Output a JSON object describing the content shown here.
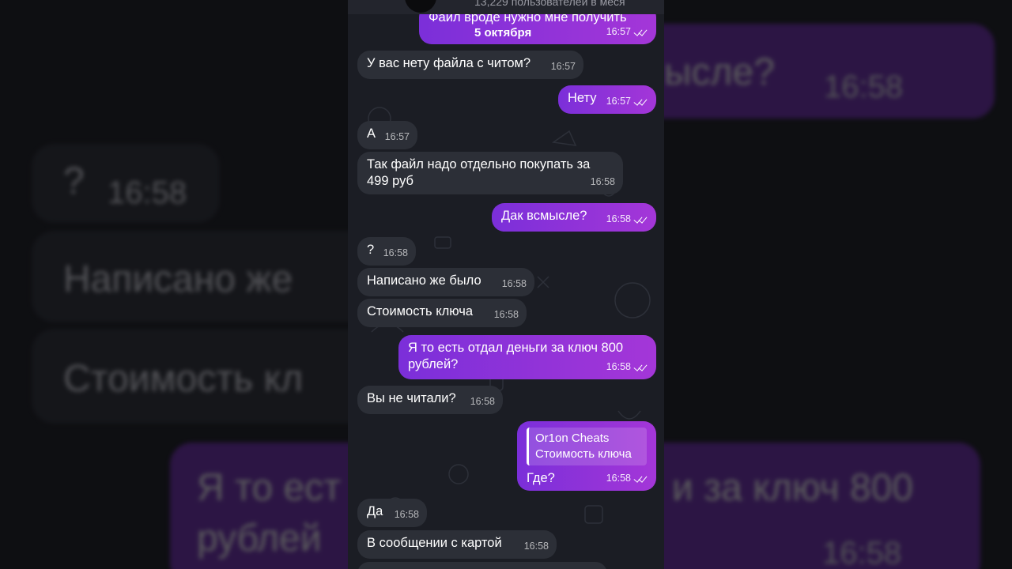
{
  "header": {
    "subtitle": "13,229 пользователей в меся"
  },
  "date_label": "5 октября",
  "colors": {
    "incoming_bubble": "#2c2f37",
    "outgoing_gradient_start": "#7b2fd9",
    "outgoing_gradient_end": "#a436d8",
    "chat_background": "#1b1d24"
  },
  "icons": {
    "read_receipt": "double-check-icon"
  },
  "messages": [
    {
      "dir": "out",
      "text": "Файл вроде нужно мне получить",
      "time": "16:57"
    },
    {
      "dir": "in",
      "text": "У вас нету файла с читом?",
      "time": "16:57"
    },
    {
      "dir": "out",
      "text": "Нету",
      "time": "16:57"
    },
    {
      "dir": "in",
      "text": "А",
      "time": "16:57"
    },
    {
      "dir": "in",
      "text": "Так файл надо отдельно покупать за",
      "text2": "499 руб",
      "time": "16:58"
    },
    {
      "dir": "out",
      "text": "Дак всмысле?",
      "time": "16:58"
    },
    {
      "dir": "in",
      "text": "?",
      "time": "16:58"
    },
    {
      "dir": "in",
      "text": "Написано же было",
      "time": "16:58"
    },
    {
      "dir": "in",
      "text": "Стоимость ключа",
      "time": "16:58"
    },
    {
      "dir": "out",
      "text": "Я то есть отдал деньги за ключ 800",
      "text2": "рублей?",
      "time": "16:58"
    },
    {
      "dir": "in",
      "text": "Вы не читали?",
      "time": "16:58"
    },
    {
      "dir": "out",
      "reply_author": "Or1on Cheats",
      "reply_text": "Стоимость ключа",
      "text": "Где?",
      "time": "16:58"
    },
    {
      "dir": "in",
      "text": "Да",
      "time": "16:58"
    },
    {
      "dir": "in",
      "text": "В сообщении с картой",
      "time": "16:58"
    }
  ],
  "background_zoom": {
    "texts": [
      "ысле?",
      "16:58",
      "?",
      "16:58",
      "Написано же",
      "Стоимость кл",
      "Я то ест",
      "и за ключ 800",
      "рублей",
      "16:58"
    ]
  }
}
